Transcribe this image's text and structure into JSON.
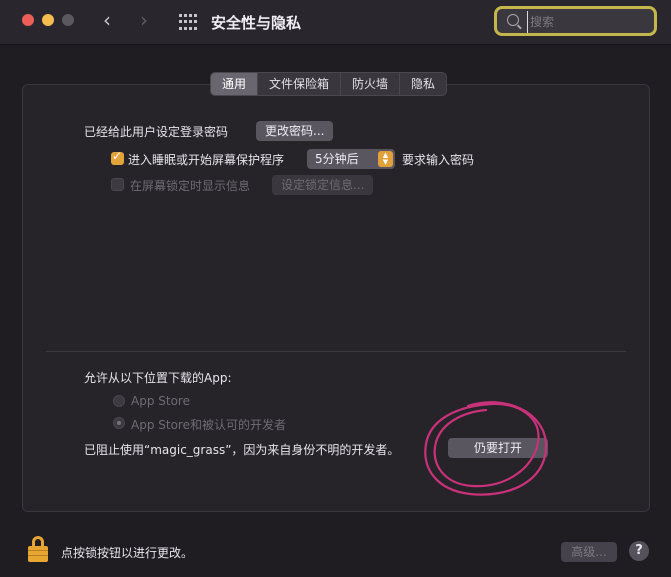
{
  "window": {
    "title": "安全性与隐私",
    "back_icon": "‹",
    "forward_icon": "›"
  },
  "search": {
    "placeholder": "搜索",
    "value": ""
  },
  "tabs": [
    {
      "label": "通用",
      "active": true
    },
    {
      "label": "文件保险箱",
      "active": false
    },
    {
      "label": "防火墙",
      "active": false
    },
    {
      "label": "隐私",
      "active": false
    }
  ],
  "general": {
    "password_set_label": "已经给此用户设定登录密码",
    "change_password_button": "更改密码...",
    "require_password_label": "进入睡眠或开始屏幕保护程序",
    "require_password_checked": true,
    "delay_value": "5分钟后",
    "require_password_suffix": "要求输入密码",
    "show_message_label": "在屏幕锁定时显示信息",
    "show_message_checked": false,
    "set_message_button": "设定锁定信息..."
  },
  "downloads": {
    "heading": "允许从以下位置下载的App:",
    "options": [
      {
        "label": "App Store",
        "selected": false
      },
      {
        "label": "App Store和被认可的开发者",
        "selected": true
      }
    ],
    "blocked_message": "已阻止使用“magic_grass”，因为来自身份不明的开发者。",
    "open_anyway_button": "仍要打开"
  },
  "footer": {
    "lock_label": "点按锁按钮以进行更改。",
    "advanced_button": "高级...",
    "help_label": "?"
  },
  "colors": {
    "accent": "#e2a43a",
    "annotation": "#c8327a",
    "search_highlight": "#c3b64a"
  }
}
